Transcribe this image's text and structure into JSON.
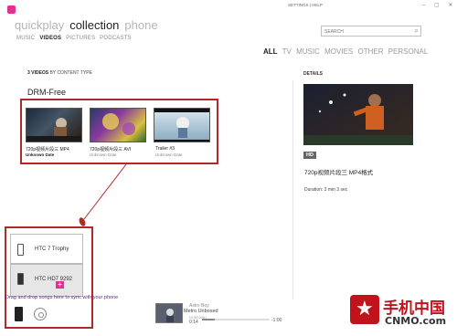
{
  "window": {
    "top_links": "SETTINGS | HELP",
    "controls": "– ▢ ✕"
  },
  "nav": {
    "items": [
      "quickplay",
      "collection",
      "phone"
    ],
    "active": "collection",
    "sub_items": [
      "MUSIC",
      "VIDEOS",
      "PICTURES",
      "PODCASTS"
    ],
    "sub_active": "VIDEOS"
  },
  "search": {
    "placeholder": "SEARCH"
  },
  "filters": {
    "items": [
      "ALL",
      "TV",
      "MUSIC",
      "MOVIES",
      "OTHER",
      "PERSONAL"
    ],
    "active": "ALL"
  },
  "list": {
    "count_label": "3 VIDEOS",
    "group_label": "BY CONTENT TYPE",
    "section_title": "DRM-Free",
    "videos": [
      {
        "title": "720p视频片段三 MP4",
        "subtitle": "Unknown Date"
      },
      {
        "title": "720p视频片段三 AVI",
        "subtitle": "Unknown Date"
      },
      {
        "title": "Trailer #3",
        "subtitle": "Unknown Date"
      }
    ]
  },
  "details": {
    "header": "DETAILS",
    "badge": "HD",
    "title": "720p视频片段三 MP4格式",
    "duration": "Duration: 3 min 3 sec"
  },
  "devices": {
    "items": [
      "HTC 7 Trophy",
      "HTC HD7 9292"
    ],
    "drag_hint": "Drag and drop songs here to sync with your phone"
  },
  "now_playing": {
    "artist": "Astro Boy",
    "title": "Metro Unboxed",
    "subtitle": "Unknown",
    "elapsed": "0:14",
    "remaining": "-1:00",
    "progress": 0.19
  },
  "watermark": {
    "logo_text": "手机中国",
    "site": "CNMO.com"
  },
  "colors": {
    "accent": "#e2318f",
    "highlight_border": "#b12a2a"
  }
}
